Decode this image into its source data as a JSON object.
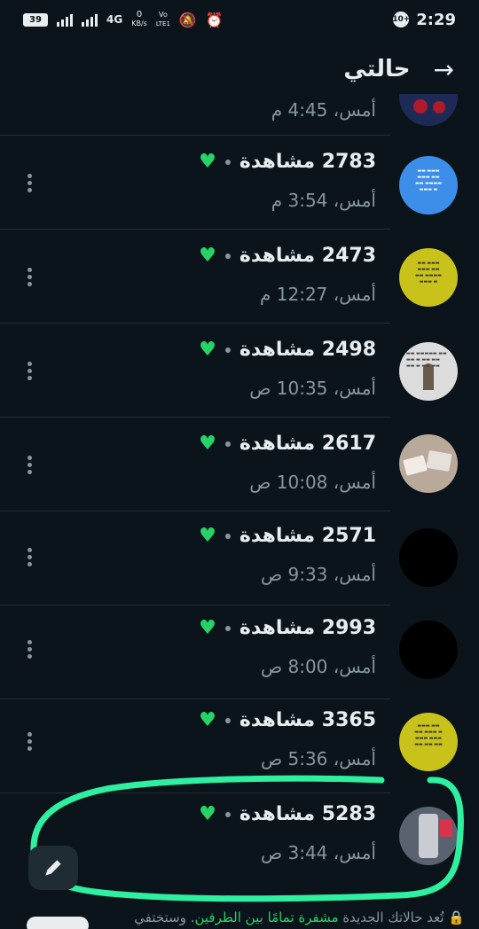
{
  "status_bar": {
    "battery": "39",
    "network": "4G",
    "speed_value": "0",
    "speed_unit": "KB/s",
    "volte": "Vo",
    "volte2": "LTE1",
    "badge": "10+",
    "time": "2:29"
  },
  "header": {
    "title": "حالتي",
    "back_icon": "arrow-right-icon"
  },
  "statuses": [
    {
      "views": "",
      "time": "أمس، 4:45 م",
      "avatar_color": "#1d2a55"
    },
    {
      "views": "2783 مشاهدة",
      "time": "أمس، 3:54 م",
      "avatar_color": "#3d8ee8"
    },
    {
      "views": "2473 مشاهدة",
      "time": "أمس، 12:27 م",
      "avatar_color": "#c8c21a"
    },
    {
      "views": "2498 مشاهدة",
      "time": "أمس، 10:35 ص",
      "avatar_color": "#dcdcdc"
    },
    {
      "views": "2617 مشاهدة",
      "time": "أمس، 10:08 ص",
      "avatar_color": "#b9a99a"
    },
    {
      "views": "2571 مشاهدة",
      "time": "أمس، 9:33 ص",
      "avatar_color": "#000000"
    },
    {
      "views": "2993 مشاهدة",
      "time": "أمس، 8:00 ص",
      "avatar_color": "#000000"
    },
    {
      "views": "3365 مشاهدة",
      "time": "أمس، 5:36 ص",
      "avatar_color": "#c8c21a"
    },
    {
      "views": "5283 مشاهدة",
      "time": "أمس، 3:44 ص",
      "avatar_color": "#5a6270"
    }
  ],
  "footer": {
    "text_before": "تُعد حالاتك الجديدة ",
    "link": "مشفرة تمامًا بين الطرفين",
    "text_after": ". وستختفي"
  },
  "fab": {
    "icon": "pencil-icon"
  },
  "colors": {
    "background": "#0b141a",
    "accent": "#25d366",
    "highlight": "#2ef0a0"
  }
}
